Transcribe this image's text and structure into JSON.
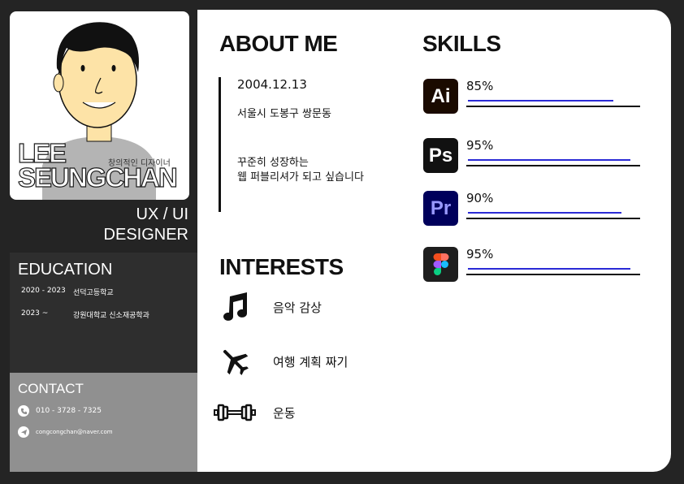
{
  "profile": {
    "last_name": "LEE",
    "first_name": "SEUNGCHAN",
    "tagline": "창의적인 디자이너",
    "role_line1": "UX / UI",
    "role_line2": "DESIGNER"
  },
  "education": {
    "title": "EDUCATION",
    "items": [
      {
        "years": "2020 - 2023",
        "school": "선덕고등학교"
      },
      {
        "years": "2023 ~",
        "school": "강원대학교 신소재공학과"
      }
    ]
  },
  "contact": {
    "title": "CONTACT",
    "phone": "010 - 3728 - 7325",
    "email": "congcongchan@naver.com",
    "phone_icon": "phone-icon",
    "email_icon": "send-icon"
  },
  "about": {
    "title": "ABOUT ME",
    "birth": "2004.12.13",
    "address": "서울시 도봉구 쌍문동",
    "goal_line1": "꾸준히 성장하는",
    "goal_line2": "웹 퍼블리셔가 되고 싶습니다"
  },
  "interests": {
    "title": "INTERESTS",
    "items": [
      {
        "icon": "music-note-icon",
        "label": "음악 감상"
      },
      {
        "icon": "airplane-icon",
        "label": "여행 계획 짜기"
      },
      {
        "icon": "dumbbell-icon",
        "label": "운동"
      }
    ]
  },
  "skills": {
    "title": "SKILLS",
    "items": [
      {
        "icon": "illustrator-icon",
        "abbr": "Ai",
        "percent_label": "85%",
        "level": 0.85,
        "bg": "#1a0a00",
        "fg": "#ffffff"
      },
      {
        "icon": "photoshop-icon",
        "abbr": "Ps",
        "percent_label": "95%",
        "level": 0.95,
        "bg": "#111111",
        "fg": "#ffffff"
      },
      {
        "icon": "premiere-icon",
        "abbr": "Pr",
        "percent_label": "90%",
        "level": 0.9,
        "bg": "#00005b",
        "fg": "#9999ff"
      },
      {
        "icon": "figma-icon",
        "abbr": "",
        "percent_label": "95%",
        "level": 0.95,
        "bg": "#1e1e1e",
        "fg": "#ffffff"
      }
    ]
  },
  "colors": {
    "background": "#242424",
    "bar_fill": "#2a2ad6",
    "contact_panel": "#909090"
  }
}
